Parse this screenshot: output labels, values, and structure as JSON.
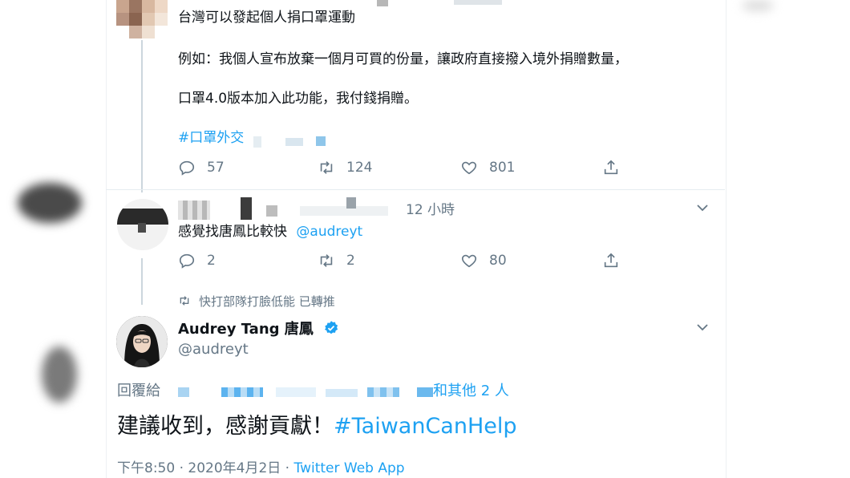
{
  "tweet1": {
    "line1": "台灣可以發起個人捐口罩運動",
    "line2": "例如：我個人宣布放棄一個月可買的份量，讓政府直接撥入境外捐贈數量，",
    "line3": "口罩4.0版本加入此功能，我付錢捐贈。",
    "hashtag": "#口罩外交",
    "replies": "57",
    "retweets": "124",
    "likes": "801"
  },
  "tweet2": {
    "time": "12 小時",
    "text": "感覺找唐鳳比較快",
    "mention": "@audreyt",
    "replies": "2",
    "retweets": "2",
    "likes": "80"
  },
  "main": {
    "retweeted_by": "快打部隊打臉低能 已轉推",
    "name": "Audrey Tang 唐鳳",
    "handle": "@audreyt",
    "reply_prefix": "回覆給",
    "reply_suffix": "和其他 2 人",
    "text": "建議收到，感謝貢獻！",
    "hashtag": "#TaiwanCanHelp",
    "meta_time": "下午8:50 · 2020年4月2日 · ",
    "meta_source": "Twitter Web App"
  },
  "colors": {
    "accent": "#1da1f2",
    "muted": "#657786",
    "line": "#ccd6dd"
  }
}
